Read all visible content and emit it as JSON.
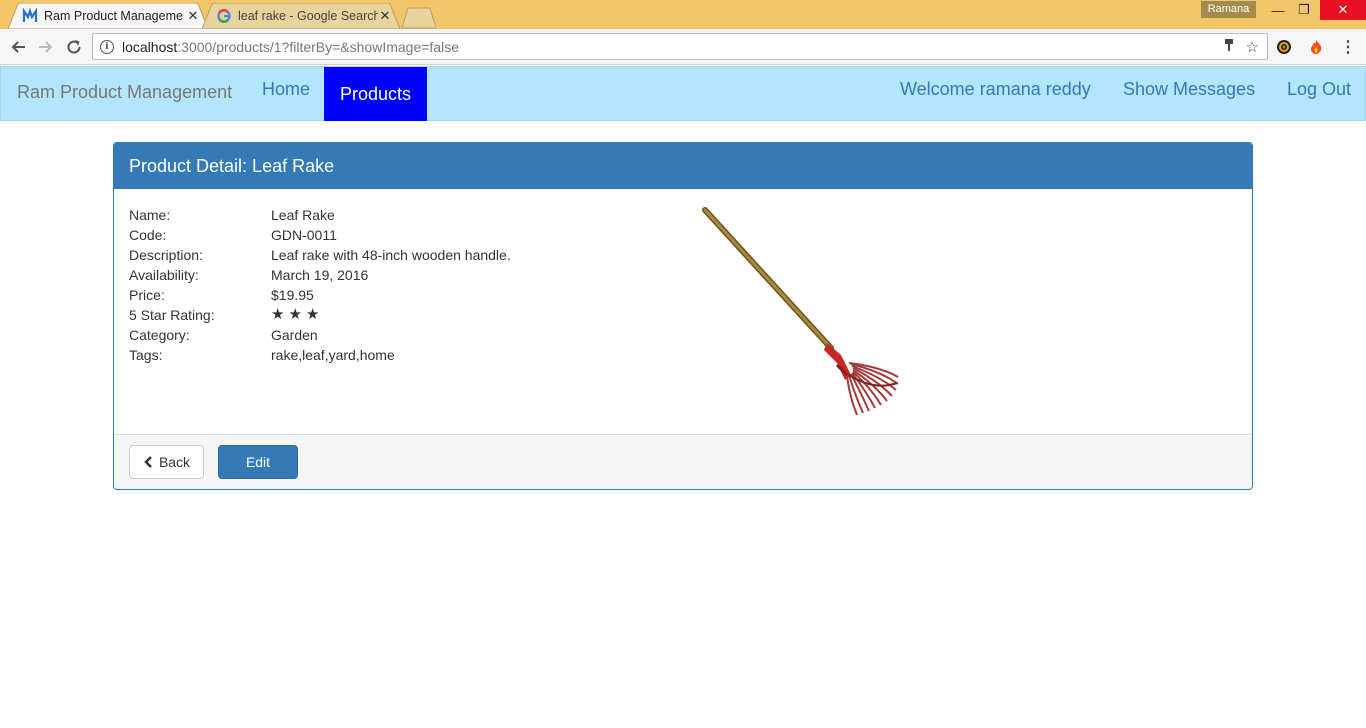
{
  "browser": {
    "tabs": [
      {
        "title": "Ram Product Manageme",
        "active": true,
        "icon": "app-logo-icon"
      },
      {
        "title": "leaf rake - Google Search",
        "active": false,
        "icon": "google-icon"
      }
    ],
    "profile_name": "Ramana",
    "url_host": "localhost",
    "url_rest": ":3000/products/1?filterBy=&showImage=false"
  },
  "navbar": {
    "brand": "Ram Product Management",
    "home": "Home",
    "products": "Products",
    "welcome": "Welcome ramana reddy",
    "show_messages": "Show Messages",
    "logout": "Log Out",
    "active_color": "#0000ff",
    "bg_color": "#b3e5fc"
  },
  "panel": {
    "heading": "Product Detail: Leaf Rake",
    "fields": [
      {
        "label": "Name:",
        "value": "Leaf Rake"
      },
      {
        "label": "Code:",
        "value": "GDN-0011"
      },
      {
        "label": "Description:",
        "value": "Leaf rake with 48-inch wooden handle."
      },
      {
        "label": "Availability:",
        "value": "March 19, 2016"
      },
      {
        "label": "Price:",
        "value": "$19.95"
      },
      {
        "label": "5 Star Rating:",
        "value": ""
      },
      {
        "label": "Category:",
        "value": "Garden"
      },
      {
        "label": "Tags:",
        "value": "rake,leaf,yard,home"
      }
    ],
    "rating": 3,
    "back_label": "Back",
    "edit_label": "Edit",
    "accent": "#337ab7"
  }
}
